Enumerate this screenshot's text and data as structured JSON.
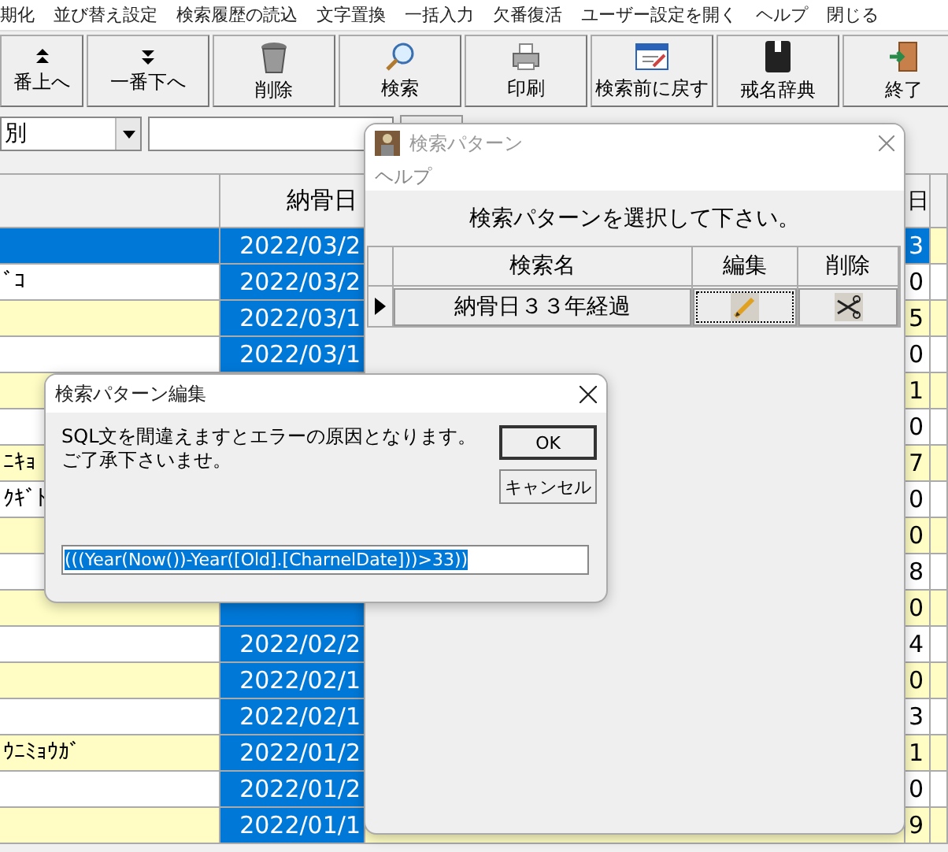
{
  "menu": [
    "期化",
    "並び替え設定",
    "検索履歴の読込",
    "文字置換",
    "一括入力",
    "欠番復活",
    "ユーザー設定を開く",
    "ヘルプ",
    "閉じる"
  ],
  "toolbar": [
    "番上へ",
    "一番下へ",
    "削除",
    "検索",
    "印刷",
    "検索前に戻す",
    "戒名辞典",
    "終了"
  ],
  "filter": {
    "dropdown": "別"
  },
  "grid": {
    "columns": [
      "納骨日",
      "日"
    ],
    "rows": [
      {
        "selected": true,
        "date": "2022/03/2",
        "day": "3"
      },
      {
        "selected": false,
        "name": "ﾞｺ",
        "date": "2022/03/2",
        "day": "0"
      },
      {
        "selected": false,
        "date": "2022/03/1",
        "day": "5"
      },
      {
        "selected": false,
        "date": "2022/03/1",
        "day": "0"
      },
      {
        "selected": false,
        "day": "1"
      },
      {
        "selected": false,
        "day": "0"
      },
      {
        "selected": false,
        "name": "ﾆｷｮ",
        "day": "7"
      },
      {
        "selected": false,
        "name": "ｸｷﾞﾄ",
        "day": "0"
      },
      {
        "selected": false,
        "day": "0"
      },
      {
        "selected": false,
        "day": "8"
      },
      {
        "selected": false,
        "day": "0"
      },
      {
        "selected": false,
        "date": "2022/02/2",
        "day": "4"
      },
      {
        "selected": false,
        "date": "2022/02/1",
        "day": "0"
      },
      {
        "selected": false,
        "date": "2022/02/1",
        "day": "3"
      },
      {
        "selected": false,
        "name": "ｳﾆﾐｮｳｶﾞ",
        "date": "2022/01/2",
        "day": "1"
      },
      {
        "selected": false,
        "date": "2022/01/2",
        "day": "0"
      },
      {
        "selected": false,
        "date": "2022/01/1",
        "day": "9"
      }
    ]
  },
  "search_dialog": {
    "title": "検索パターン",
    "active": false,
    "menu": [
      "ヘルプ"
    ],
    "prompt": "検索パターンを選択して下さい。",
    "columns": [
      "検索名",
      "編集",
      "削除"
    ],
    "rows": [
      {
        "name": "納骨日３３年経過",
        "current": true
      }
    ]
  },
  "edit_dialog": {
    "title": "検索パターン編集",
    "active": true,
    "message": "SQL文を間違えますとエラーの原因となります。ご了承下さいませ。",
    "buttons": [
      {
        "label": "OK",
        "default": true
      },
      {
        "label": "キャンセル",
        "default": false
      }
    ],
    "sql": {
      "value": "(((Year(Now())-Year([Old].[CharnelDate]))>33))",
      "selected": true
    }
  }
}
